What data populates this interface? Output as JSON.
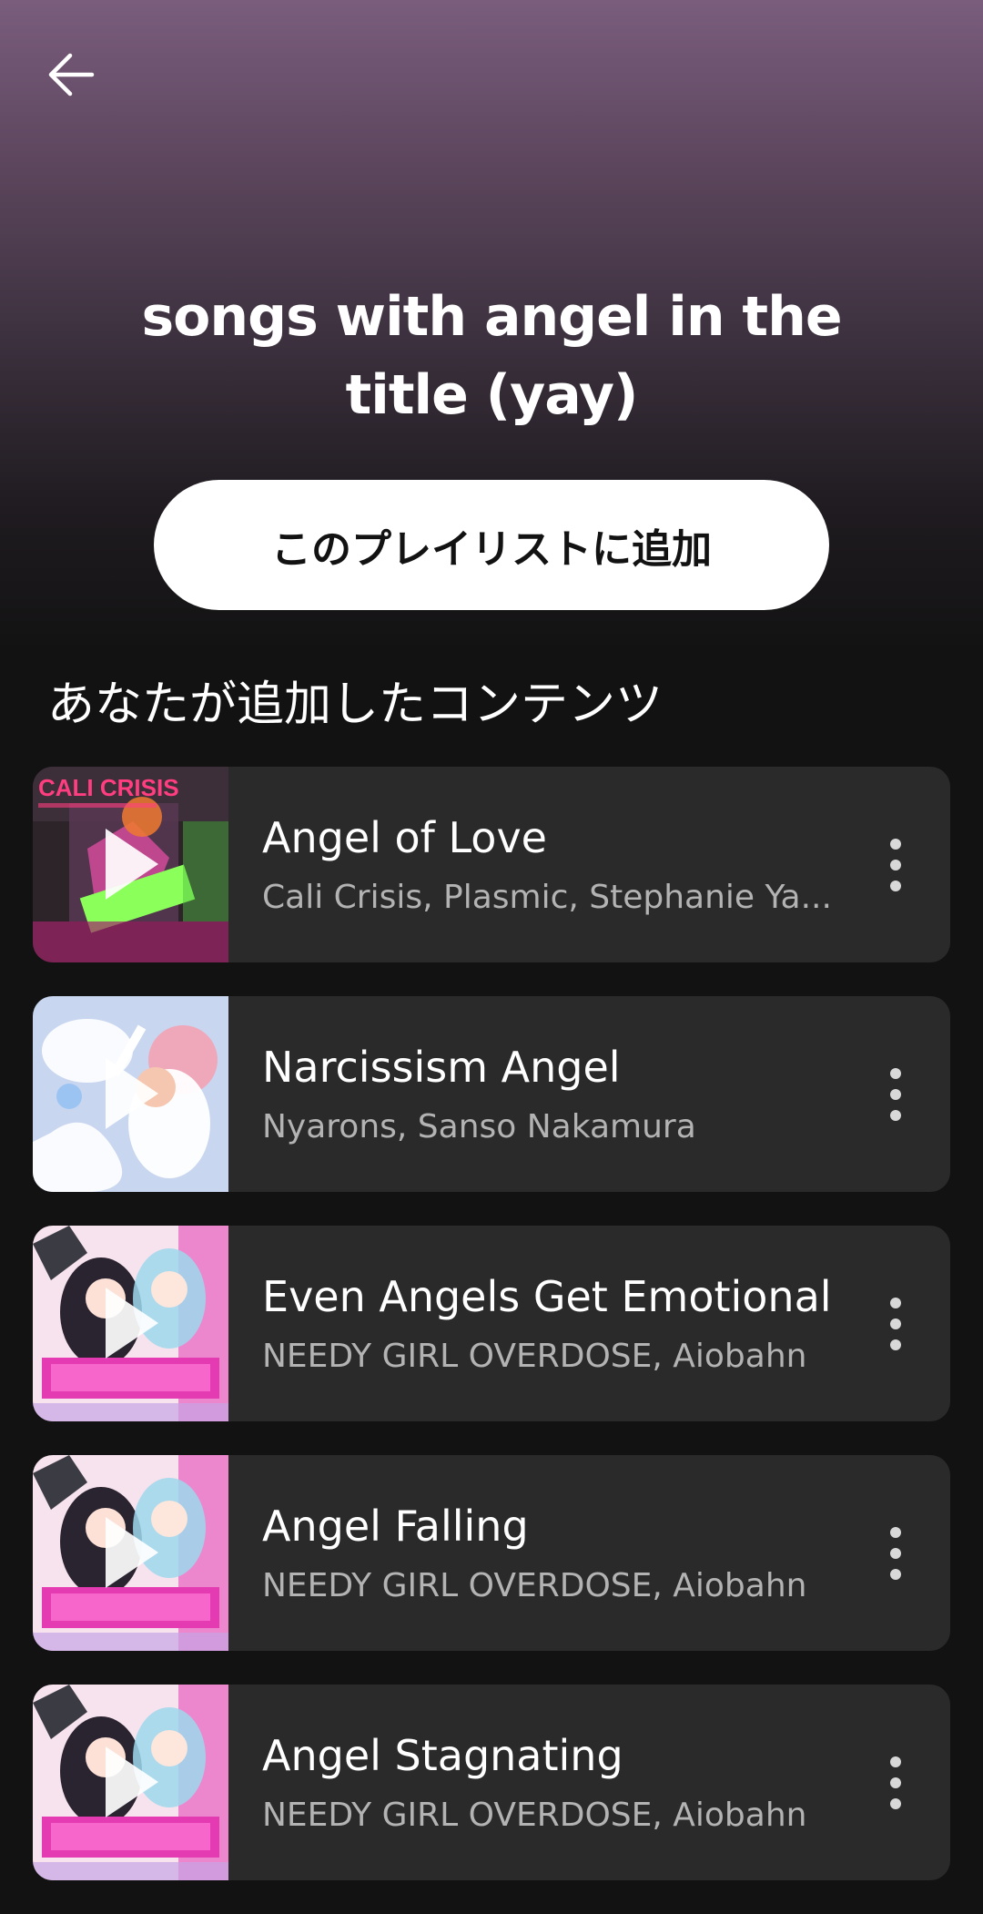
{
  "header": {
    "back_icon": "arrow-left-icon",
    "title": "songs with angel in the title (yay)"
  },
  "actions": {
    "add_to_playlist_label": "このプレイリストに追加"
  },
  "section": {
    "heading": "あなたが追加したコンテンツ"
  },
  "tracks": [
    {
      "title": "Angel of Love",
      "artists": "Cali Crisis, Plasmic, Stephanie Ya...",
      "artwork_label": "CALI CRISIS",
      "artwork_colors": [
        "#3a2a2e",
        "#e0407a",
        "#6aff4a"
      ]
    },
    {
      "title": "Narcissism Angel",
      "artists": "Nyarons, Sanso Nakamura",
      "artwork_colors": [
        "#cfd9f2",
        "#f3a3b4",
        "#ffffff"
      ]
    },
    {
      "title": "Even Angels Get Emotional",
      "artists": "NEEDY GIRL OVERDOSE, Aiobahn",
      "artwork_colors": [
        "#fbe7f2",
        "#e43bb2",
        "#7ec8e9"
      ]
    },
    {
      "title": "Angel Falling",
      "artists": "NEEDY GIRL OVERDOSE, Aiobahn",
      "artwork_colors": [
        "#fbe7f2",
        "#e43bb2",
        "#7ec8e9"
      ]
    },
    {
      "title": "Angel Stagnating",
      "artists": "NEEDY GIRL OVERDOSE, Aiobahn",
      "artwork_colors": [
        "#fbe7f2",
        "#e43bb2",
        "#7ec8e9"
      ]
    }
  ],
  "icons": {
    "play": "play-icon",
    "more": "more-vertical-icon"
  },
  "colors": {
    "header_gradient_top": "#7a5d7d",
    "background": "#121212",
    "card": "#2a2a2a",
    "secondary_text": "#b3b3b3"
  }
}
